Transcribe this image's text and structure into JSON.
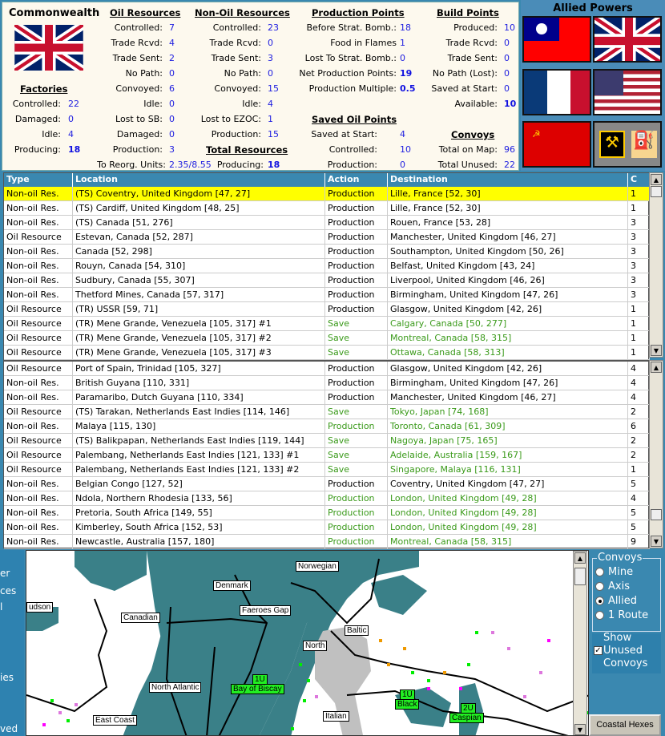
{
  "nation": {
    "title": "Commonwealth"
  },
  "factories": {
    "heading": "Factories",
    "rows": [
      {
        "label": "Controlled:",
        "value": "22"
      },
      {
        "label": "Damaged:",
        "value": "0"
      },
      {
        "label": "Idle:",
        "value": "4"
      },
      {
        "label": "Producing:",
        "value": "18"
      }
    ]
  },
  "oil": {
    "heading": "Oil Resources",
    "rows": [
      {
        "label": "Controlled:",
        "value": "7"
      },
      {
        "label": "Trade Rcvd:",
        "value": "4"
      },
      {
        "label": "Trade Sent:",
        "value": "2"
      },
      {
        "label": "No Path:",
        "value": "0"
      },
      {
        "label": "Convoyed:",
        "value": "6"
      },
      {
        "label": "Idle:",
        "value": "0"
      },
      {
        "label": "Lost to SB:",
        "value": "0"
      },
      {
        "label": "Damaged:",
        "value": "0"
      },
      {
        "label": "Production:",
        "value": "3"
      }
    ],
    "reorg_label": "To Reorg. Units:",
    "reorg_value": "2.35/8.55"
  },
  "nonoil": {
    "heading": "Non-Oil Resources",
    "rows": [
      {
        "label": "Controlled:",
        "value": "23"
      },
      {
        "label": "Trade Rcvd:",
        "value": "0"
      },
      {
        "label": "Trade Sent:",
        "value": "3"
      },
      {
        "label": "No Path:",
        "value": "0"
      },
      {
        "label": "Convoyed:",
        "value": "15"
      },
      {
        "label": "Idle:",
        "value": "4"
      },
      {
        "label": "Lost to EZOC:",
        "value": "1"
      },
      {
        "label": "Production:",
        "value": "15"
      }
    ]
  },
  "total": {
    "heading": "Total Resources",
    "label": "Producing:",
    "value": "18"
  },
  "production": {
    "heading": "Production Points",
    "rows": [
      {
        "label": "Before Strat. Bomb.:",
        "value": "18"
      },
      {
        "label": "Food in Flames",
        "value": "1"
      },
      {
        "label": "Lost To Strat. Bomb.:",
        "value": "0"
      },
      {
        "label": "Net Production Points:",
        "value": "19"
      },
      {
        "label": "Production Multiple:",
        "value": "0.5"
      }
    ]
  },
  "saved_oil": {
    "heading": "Saved Oil Points",
    "rows": [
      {
        "label": "Saved at Start:",
        "value": "4"
      },
      {
        "label": "Controlled:",
        "value": "10"
      },
      {
        "label": "Production:",
        "value": "0"
      }
    ]
  },
  "build": {
    "heading": "Build Points",
    "rows": [
      {
        "label": "Produced:",
        "value": "10"
      },
      {
        "label": "Trade Rcvd:",
        "value": "0"
      },
      {
        "label": "Trade Sent:",
        "value": "0"
      },
      {
        "label": "No Path (Lost):",
        "value": "0"
      },
      {
        "label": "Saved at Start:",
        "value": "0"
      },
      {
        "label": "Available:",
        "value": "10"
      }
    ]
  },
  "convoys": {
    "heading": "Convoys",
    "rows": [
      {
        "label": "Total on Map:",
        "value": "96"
      },
      {
        "label": "Total Unused:",
        "value": "22"
      }
    ]
  },
  "allied": {
    "title": "Allied Powers"
  },
  "table": {
    "headers": [
      "Type",
      "Location",
      "Action",
      "Destination",
      "C"
    ],
    "rows_top": [
      [
        "Non-oil Res.",
        "(TS) Coventry, United Kingdom [47, 27]",
        "Production",
        "Lille, France [52, 30]",
        "1"
      ],
      [
        "Non-oil Res.",
        "(TS) Cardiff, United Kingdom [48, 25]",
        "Production",
        "Lille, France [52, 30]",
        "1"
      ],
      [
        "Non-oil Res.",
        "(TS) Canada [51, 276]",
        "Production",
        "Rouen, France [53, 28]",
        "3"
      ],
      [
        "Oil Resource",
        "Estevan, Canada [52, 287]",
        "Production",
        "Manchester, United Kingdom [46, 27]",
        "3"
      ],
      [
        "Non-oil Res.",
        "Canada [52, 298]",
        "Production",
        "Southampton, United Kingdom [50, 26]",
        "3"
      ],
      [
        "Non-oil Res.",
        "Rouyn, Canada [54, 310]",
        "Production",
        "Belfast, United Kingdom [43, 24]",
        "3"
      ],
      [
        "Non-oil Res.",
        "Sudbury, Canada [55, 307]",
        "Production",
        "Liverpool, United Kingdom [46, 26]",
        "3"
      ],
      [
        "Non-oil Res.",
        "Thetford Mines, Canada [57, 317]",
        "Production",
        "Birmingham, United Kingdom [47, 26]",
        "3"
      ],
      [
        "Oil Resource",
        "(TR) USSR [59, 71]",
        "Production",
        "Glasgow, United Kingdom [42, 26]",
        "1"
      ],
      [
        "Oil Resource",
        "(TR) Mene Grande, Venezuela [105, 317] #1",
        "Save",
        "Calgary, Canada [50, 277]",
        "1"
      ],
      [
        "Oil Resource",
        "(TR) Mene Grande, Venezuela [105, 317] #2",
        "Save",
        "Montreal, Canada [58, 315]",
        "1"
      ],
      [
        "Oil Resource",
        "(TR) Mene Grande, Venezuela [105, 317] #3",
        "Save",
        "Ottawa, Canada [58, 313]",
        "1"
      ]
    ],
    "rows_bottom": [
      [
        "Oil Resource",
        "Port of Spain, Trinidad [105, 327]",
        "Production",
        "Glasgow, United Kingdom [42, 26]",
        "4"
      ],
      [
        "Non-oil Res.",
        "British Guyana [110, 331]",
        "Production",
        "Birmingham, United Kingdom [47, 26]",
        "4"
      ],
      [
        "Non-oil Res.",
        "Paramaribo, Dutch Guyana [110, 334]",
        "Production",
        "Manchester, United Kingdom [46, 27]",
        "4"
      ],
      [
        "Oil Resource",
        "(TS) Tarakan, Netherlands East Indies [114, 146]",
        "Save",
        "Tokyo, Japan [74, 168]",
        "2"
      ],
      [
        "Non-oil Res.",
        "Malaya [115, 130]",
        "Production",
        "Toronto, Canada [61, 309]",
        "6"
      ],
      [
        "Oil Resource",
        "(TS) Balikpapan, Netherlands East Indies [119, 144]",
        "Save",
        "Nagoya, Japan [75, 165]",
        "2"
      ],
      [
        "Oil Resource",
        "Palembang, Netherlands East Indies [121, 133] #1",
        "Save",
        "Adelaide, Australia [159, 167]",
        "2"
      ],
      [
        "Oil Resource",
        "Palembang, Netherlands East Indies [121, 133] #2",
        "Save",
        "Singapore, Malaya [116, 131]",
        "1"
      ],
      [
        "Non-oil Res.",
        "Belgian Congo [127, 52]",
        "Production",
        "Coventry, United Kingdom [47, 27]",
        "5"
      ],
      [
        "Non-oil Res.",
        "Ndola, Northern Rhodesia [133, 56]",
        "Production",
        "London, United Kingdom [49, 28]",
        "4"
      ],
      [
        "Non-oil Res.",
        "Pretoria, South Africa [149, 55]",
        "Production",
        "London, United Kingdom [49, 28]",
        "5"
      ],
      [
        "Non-oil Res.",
        "Kimberley, South Africa [152, 53]",
        "Production",
        "London, United Kingdom [49, 28]",
        "5"
      ],
      [
        "Non-oil Res.",
        "Newcastle, Australia [157, 180]",
        "Production",
        "Montreal, Canada [58, 315]",
        "9"
      ]
    ],
    "green_rows_bottom": [
      4,
      9,
      10,
      11,
      12
    ]
  },
  "map": {
    "labels": [
      "Norwegian",
      "Denmark",
      "Faeroes Gap",
      "Canadian",
      "udson",
      "Baltic",
      "North",
      "North Atlantic",
      "East Coast",
      "Italian"
    ],
    "convoys": [
      {
        "count": "1U",
        "zone": "Bay of Biscay"
      },
      {
        "count": "1U",
        "zone": "Black"
      },
      {
        "count": "2U",
        "zone": "Caspian"
      }
    ]
  },
  "left_panel": {
    "fragments": [
      "er",
      "ces",
      "l",
      "ies",
      "ved"
    ]
  },
  "controls": {
    "group_title": "Convoys",
    "options": [
      "Mine",
      "Axis",
      "Allied",
      "1 Route"
    ],
    "selected": "Allied",
    "show_unused": [
      "Show",
      "Unused",
      "Convoys"
    ],
    "show_unused_checked": true,
    "coastal_button": "Coastal Hexes"
  },
  "colors": {
    "accent": "#3a88b0",
    "value": "#2020e0",
    "highlight": "#ffff00",
    "save": "#3a9a1a",
    "ocean": "#3a8088"
  }
}
